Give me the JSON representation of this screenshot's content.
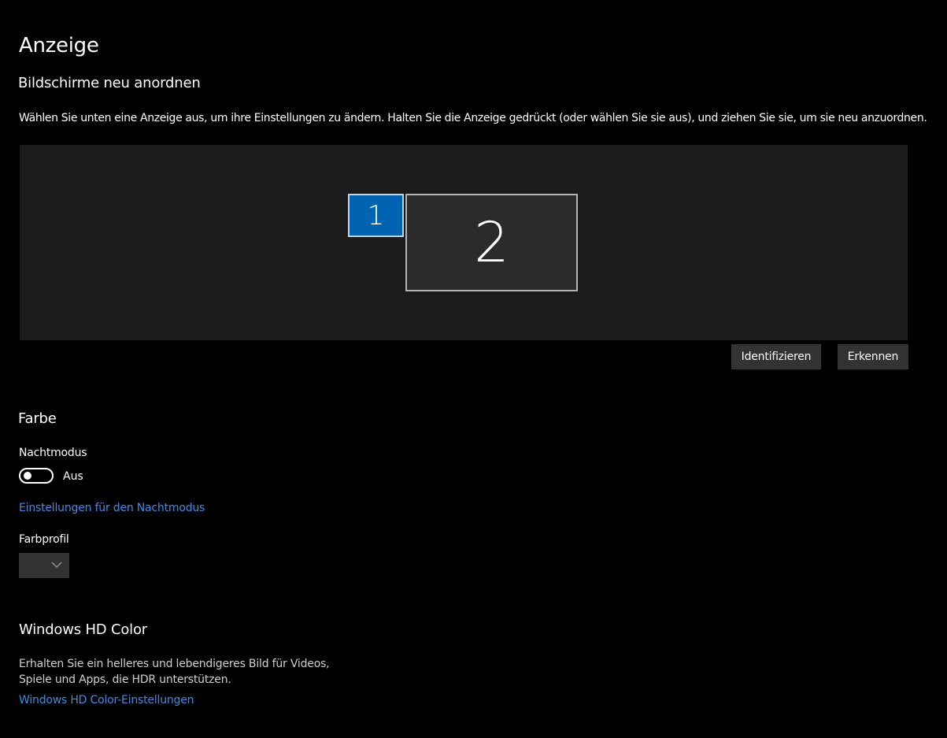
{
  "page": {
    "title": "Anzeige"
  },
  "arrange": {
    "heading": "Bildschirme neu anordnen",
    "description": "Wählen Sie unten eine Anzeige aus, um ihre Einstellungen zu ändern. Halten Sie die Anzeige gedrückt (oder wählen Sie sie aus), und ziehen Sie sie, um sie neu anzuordnen.",
    "monitors": [
      {
        "label": "1",
        "selected": true
      },
      {
        "label": "2",
        "selected": false
      }
    ],
    "identify_label": "Identifizieren",
    "detect_label": "Erkennen"
  },
  "color": {
    "heading": "Farbe",
    "night_mode_label": "Nachtmodus",
    "night_mode_state": "Aus",
    "night_mode_on": false,
    "night_mode_settings_link": "Einstellungen für den Nachtmodus",
    "color_profile_label": "Farbprofil",
    "color_profile_value": ""
  },
  "hd_color": {
    "heading": "Windows HD Color",
    "description": "Erhalten Sie ein helleres und lebendigeres Bild für Videos, Spiele und Apps, die HDR unterstützen.",
    "settings_link": "Windows HD Color-Einstellungen"
  },
  "colors": {
    "background": "#000000",
    "canvas": "#1b1b1b",
    "accent_selected_monitor": "#0063b1",
    "button": "#333333",
    "link": "#3a8ee6"
  },
  "icons": {
    "dropdown": "chevron-down-icon",
    "toggle_knob": "toggle-knob"
  }
}
